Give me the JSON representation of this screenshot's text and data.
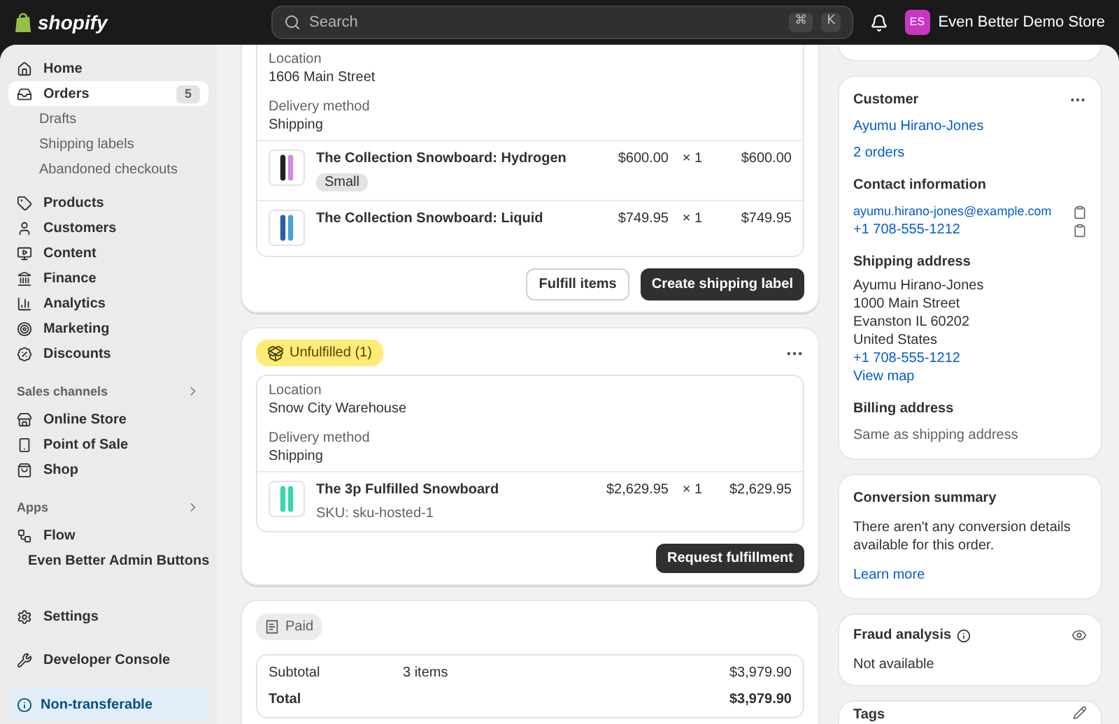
{
  "header": {
    "brand": "shopify",
    "search": {
      "placeholder": "Search"
    },
    "shortcut": [
      "⌘",
      "K"
    ],
    "store": {
      "initials": "ES",
      "name": "Even Better Demo Store"
    }
  },
  "sidebar": {
    "items": [
      {
        "label": "Home",
        "selected": false
      },
      {
        "label": "Orders",
        "selected": true,
        "count": "5",
        "children": [
          {
            "label": "Drafts"
          },
          {
            "label": "Shipping labels"
          },
          {
            "label": "Abandoned checkouts"
          }
        ]
      },
      {
        "label": "Products",
        "selected": false
      },
      {
        "label": "Customers",
        "selected": false
      },
      {
        "label": "Content",
        "selected": false
      },
      {
        "label": "Finance",
        "selected": false
      },
      {
        "label": "Analytics",
        "selected": false
      },
      {
        "label": "Marketing",
        "selected": false
      },
      {
        "label": "Discounts",
        "selected": false
      }
    ],
    "sections": [
      {
        "title": "Sales channels",
        "items": [
          {
            "label": "Online Store"
          },
          {
            "label": "Point of Sale"
          },
          {
            "label": "Shop"
          }
        ]
      },
      {
        "title": "Apps",
        "items": [
          {
            "label": "Flow"
          },
          {
            "label": "Even Better Admin Buttons"
          }
        ]
      }
    ],
    "settings": "Settings",
    "developer": "Developer Console",
    "notice": "Non-transferable"
  },
  "fulfillments": [
    {
      "location_label": "Location",
      "location": "1606 Main Street",
      "method_label": "Delivery method",
      "method": "Shipping",
      "items": [
        {
          "name": "The Collection Snowboard: Hydrogen",
          "variant": "Small",
          "price": "$600.00",
          "qty": "× 1",
          "total": "$600.00"
        },
        {
          "name": "The Collection Snowboard: Liquid",
          "price": "$749.95",
          "qty": "× 1",
          "total": "$749.95"
        }
      ],
      "buttons": [
        {
          "label": "Fulfill items",
          "kind": "secondary"
        },
        {
          "label": "Create shipping label",
          "kind": "primary"
        }
      ]
    },
    {
      "badge": "Unfulfilled (1)",
      "location_label": "Location",
      "location": "Snow City Warehouse",
      "method_label": "Delivery method",
      "method": "Shipping",
      "items": [
        {
          "name": "The 3p Fulfilled Snowboard",
          "sku": "SKU: sku-hosted-1",
          "price": "$2,629.95",
          "qty": "× 1",
          "total": "$2,629.95"
        }
      ],
      "buttons": [
        {
          "label": "Request fulfillment",
          "kind": "primary"
        }
      ]
    }
  ],
  "payment": {
    "badge": "Paid",
    "rows": [
      {
        "label": "Subtotal",
        "detail": "3 items",
        "value": "$3,979.90",
        "bold": false
      },
      {
        "label": "Total",
        "value": "$3,979.90",
        "bold": true
      }
    ]
  },
  "customer": {
    "title": "Customer",
    "name": "Ayumu Hirano-Jones",
    "orders": "2 orders",
    "contact_title": "Contact information",
    "email": "ayumu.hirano-jones@example.com",
    "phone": "+1 708-555-1212",
    "shipping_title": "Shipping address",
    "address": [
      "Ayumu Hirano-Jones",
      "1000 Main Street",
      "Evanston IL 60202",
      "United States"
    ],
    "shipping_phone": "+1 708-555-1212",
    "map_link": "View map",
    "billing_title": "Billing address",
    "billing": "Same as shipping address"
  },
  "conversion": {
    "title": "Conversion summary",
    "text": "There aren't any conversion details available for this order.",
    "link": "Learn more"
  },
  "fraud": {
    "title": "Fraud analysis",
    "text": "Not available"
  },
  "tags": {
    "title": "Tags"
  }
}
